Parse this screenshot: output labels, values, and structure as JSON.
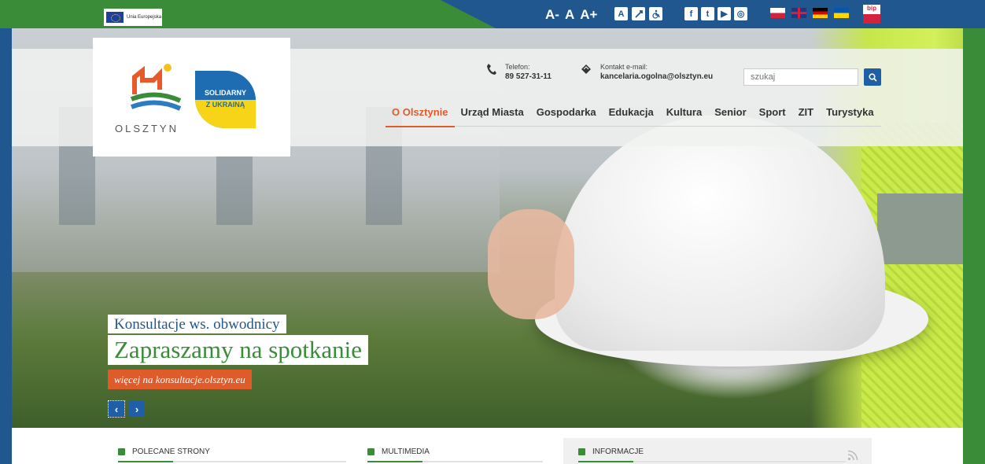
{
  "topbar": {
    "eu_label": "Unia Europejska",
    "font_size_decrease": "A-",
    "font_size_normal": "A",
    "font_size_increase": "A+",
    "a11y_icons": [
      "contrast-icon",
      "lowvision-icon",
      "wheelchair-icon"
    ],
    "contrast_label": "A",
    "social_icons": [
      "facebook-icon",
      "twitter-icon",
      "youtube-icon",
      "instagram-icon"
    ],
    "social_labels": [
      "f",
      "t",
      "▶",
      "◎"
    ],
    "flags": [
      "pl",
      "en",
      "de",
      "ua"
    ],
    "bip_label": "bip"
  },
  "header": {
    "logo_text": "OLSZTYN",
    "solidarity_line1": "SOLIDARNY",
    "solidarity_line2": "Z UKRAINĄ",
    "phone_label": "Telefon:",
    "phone_value": "89 527-31-11",
    "email_label": "Kontakt e-mail:",
    "email_value": "kancelaria.ogolna@olsztyn.eu",
    "search_placeholder": "szukaj"
  },
  "nav": {
    "items": [
      {
        "label": "O Olsztynie",
        "active": true
      },
      {
        "label": "Urząd Miasta"
      },
      {
        "label": "Gospodarka"
      },
      {
        "label": "Edukacja"
      },
      {
        "label": "Kultura"
      },
      {
        "label": "Senior"
      },
      {
        "label": "Sport"
      },
      {
        "label": "ZIT"
      },
      {
        "label": "Turystyka"
      }
    ]
  },
  "slide": {
    "subtitle": "Konsultacje ws. obwodnicy",
    "title": "Zapraszamy na spotkanie",
    "link": "więcej na konsultacje.olsztyn.eu",
    "prev": "‹",
    "next": "›"
  },
  "sections": [
    {
      "title": "POLECANE STRONY"
    },
    {
      "title": "MULTIMEDIA"
    },
    {
      "title": "INFORMACJE"
    }
  ],
  "colors": {
    "blue": "#21578f",
    "green": "#3a8c39",
    "orange": "#e05b2a"
  }
}
